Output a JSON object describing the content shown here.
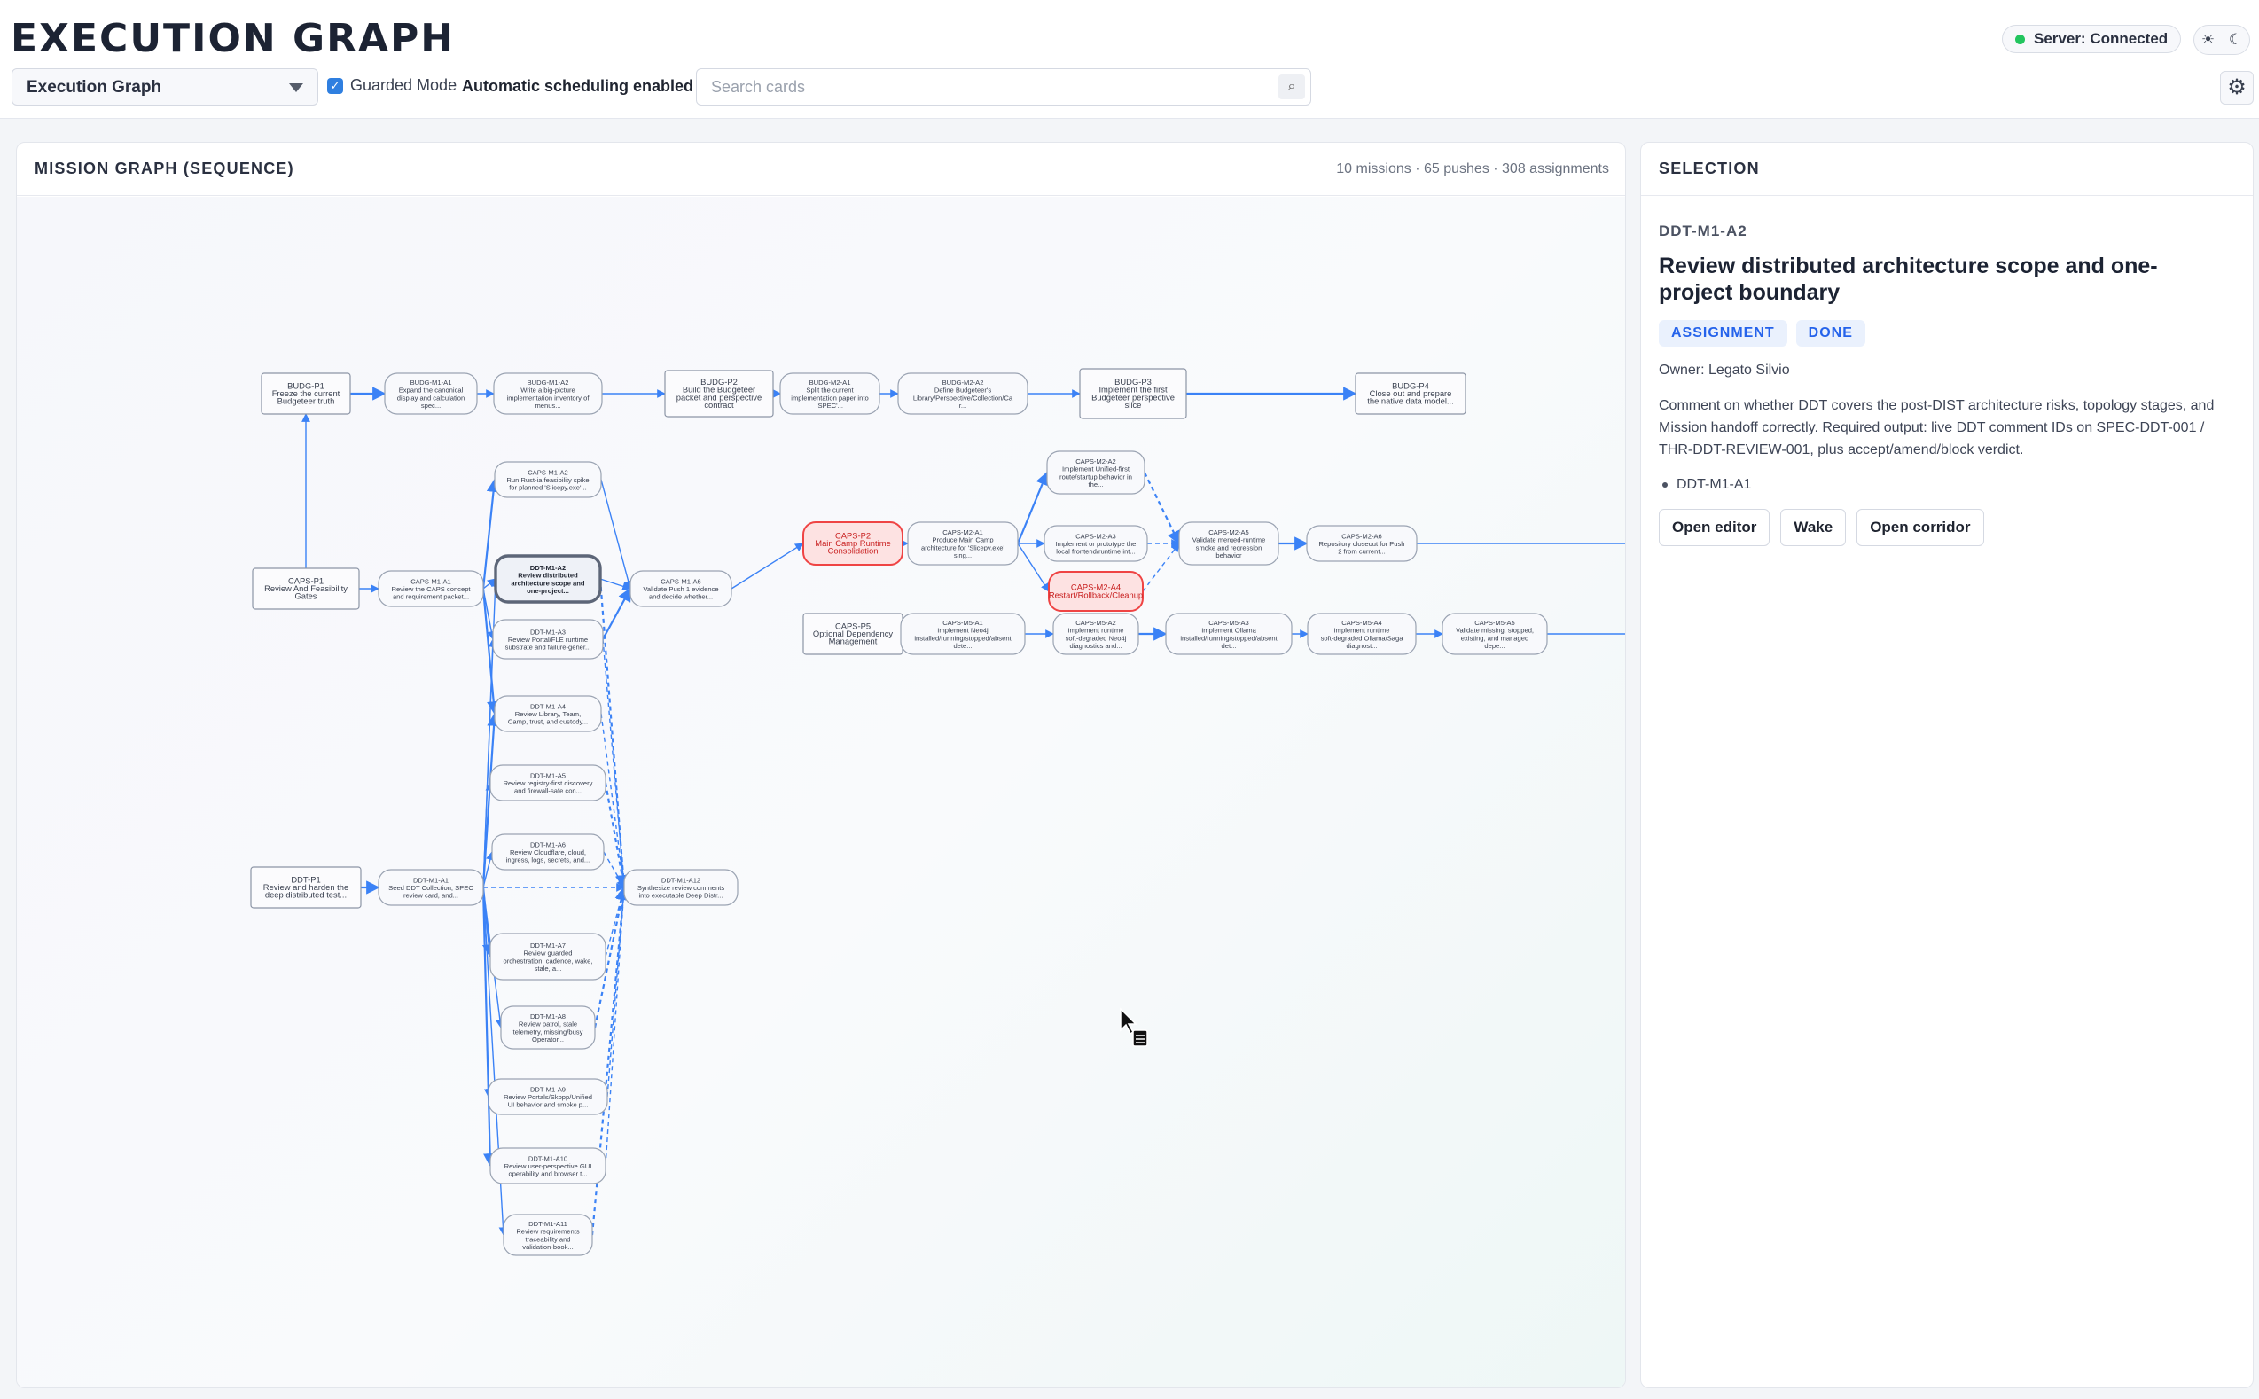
{
  "header": {
    "title": "EXECUTION GRAPH",
    "view_select": "Execution Graph",
    "guarded_mode_label": "Guarded Mode",
    "guarded_mode_checked": true,
    "scheduling_status": "Automatic scheduling enabled",
    "search_placeholder": "Search cards",
    "server_status": "Server: Connected",
    "server_status_color": "#22c55e"
  },
  "graph_panel": {
    "title": "MISSION GRAPH (SEQUENCE)",
    "stats": "10 missions · 65 pushes · 308 assignments",
    "accent_color": "#3b82f6",
    "alert_color": "#ef4444",
    "nodes": [
      {
        "id": "BUDG-P1",
        "lines": [
          "BUDG-P1",
          "Freeze the current",
          "Budgeteer truth"
        ],
        "kind": "push"
      },
      {
        "id": "BUDG-M1-A1",
        "lines": [
          "BUDG-M1-A1",
          "Expand the canonical",
          "display and calculation",
          "spec..."
        ],
        "kind": "assignment"
      },
      {
        "id": "BUDG-M1-A2",
        "lines": [
          "BUDG-M1-A2",
          "Write a big-picture",
          "implementation inventory of",
          "menus..."
        ],
        "kind": "assignment"
      },
      {
        "id": "BUDG-P2",
        "lines": [
          "BUDG-P2",
          "Build the Budgeteer",
          "packet and perspective",
          "contract"
        ],
        "kind": "push"
      },
      {
        "id": "BUDG-M2-A1",
        "lines": [
          "BUDG-M2-A1",
          "Split the current",
          "implementation paper into",
          "'SPEC'..."
        ],
        "kind": "assignment"
      },
      {
        "id": "BUDG-M2-A2",
        "lines": [
          "BUDG-M2-A2",
          "Define Budgeteer's",
          "Library/Perspective/Collection/Ca",
          "r..."
        ],
        "kind": "assignment"
      },
      {
        "id": "BUDG-P3",
        "lines": [
          "BUDG-P3",
          "Implement the first",
          "Budgeteer perspective",
          "slice"
        ],
        "kind": "push"
      },
      {
        "id": "BUDG-P4",
        "lines": [
          "BUDG-P4",
          "Close out and prepare",
          "the native data model..."
        ],
        "kind": "push"
      },
      {
        "id": "CAPS-M1-A2",
        "lines": [
          "CAPS-M1-A2",
          "Run Rust-ia feasibility spike",
          "for planned 'Slicepy.exe'..."
        ],
        "kind": "assignment"
      },
      {
        "id": "CAPS-P1",
        "lines": [
          "CAPS-P1",
          "Review And Feasibility",
          "Gates"
        ],
        "kind": "push"
      },
      {
        "id": "CAPS-M1-A1",
        "lines": [
          "CAPS-M1-A1",
          "Review the CAPS concept",
          "and requirement packet..."
        ],
        "kind": "assignment"
      },
      {
        "id": "DDT-M1-A2",
        "lines": [
          "DDT-M1-A2",
          "Review distributed",
          "architecture scope and",
          "one-project..."
        ],
        "kind": "selected"
      },
      {
        "id": "DDT-M1-A3",
        "lines": [
          "DDT-M1-A3",
          "Review Portal/FLE runtime",
          "substrate and failure-gener..."
        ],
        "kind": "assignment"
      },
      {
        "id": "CAPS-M1-A6",
        "lines": [
          "CAPS-M1-A6",
          "Validate Push 1 evidence",
          "and decide whether..."
        ],
        "kind": "assignment"
      },
      {
        "id": "CAPS-P2",
        "lines": [
          "CAPS-P2",
          "Main Camp Runtime",
          "Consolidation"
        ],
        "kind": "alert"
      },
      {
        "id": "CAPS-M2-A1",
        "lines": [
          "CAPS-M2-A1",
          "Produce Main Camp",
          "architecture for 'Slicepy.exe'",
          "sing..."
        ],
        "kind": "assignment"
      },
      {
        "id": "CAPS-M2-A2",
        "lines": [
          "CAPS-M2-A2",
          "Implement Unified-first",
          "route/startup behavior in",
          "the..."
        ],
        "kind": "assignment"
      },
      {
        "id": "CAPS-M2-A3",
        "lines": [
          "CAPS-M2-A3",
          "Implement or prototype the",
          "local frontend/runtime int..."
        ],
        "kind": "assignment"
      },
      {
        "id": "CAPS-M2-A4",
        "lines": [
          "CAPS-M2-A4",
          "Restart/Rollback/Cleanup"
        ],
        "kind": "alert"
      },
      {
        "id": "CAPS-M2-A5",
        "lines": [
          "CAPS-M2-A5",
          "Validate merged-runtime",
          "smoke and regression",
          "behavior"
        ],
        "kind": "assignment"
      },
      {
        "id": "CAPS-M2-A6",
        "lines": [
          "CAPS-M2-A6",
          "Repository closeout for Push",
          "2 from current..."
        ],
        "kind": "assignment"
      },
      {
        "id": "CAPS-P5",
        "lines": [
          "CAPS-P5",
          "Optional Dependency",
          "Management"
        ],
        "kind": "push"
      },
      {
        "id": "CAPS-M5-A1",
        "lines": [
          "CAPS-M5-A1",
          "Implement Neo4j",
          "installed/running/stopped/absent",
          "dete..."
        ],
        "kind": "assignment"
      },
      {
        "id": "CAPS-M5-A2",
        "lines": [
          "CAPS-M5-A2",
          "Implement runtime",
          "soft-degraded Neo4j",
          "diagnostics and..."
        ],
        "kind": "assignment"
      },
      {
        "id": "CAPS-M5-A3",
        "lines": [
          "CAPS-M5-A3",
          "Implement Ollama",
          "installed/running/stopped/absent",
          "det..."
        ],
        "kind": "assignment"
      },
      {
        "id": "CAPS-M5-A4",
        "lines": [
          "CAPS-M5-A4",
          "Implement runtime",
          "soft-degraded Ollama/Saga",
          "diagnost..."
        ],
        "kind": "assignment"
      },
      {
        "id": "CAPS-M5-A5",
        "lines": [
          "CAPS-M5-A5",
          "Validate missing, stopped,",
          "existing, and managed",
          "depe..."
        ],
        "kind": "assignment"
      },
      {
        "id": "DDT-M1-A4",
        "lines": [
          "DDT-M1-A4",
          "Review Library, Team,",
          "Camp, trust, and custody..."
        ],
        "kind": "assignment"
      },
      {
        "id": "DDT-M1-A5",
        "lines": [
          "DDT-M1-A5",
          "Review registry-first discovery",
          "and firewall-safe con..."
        ],
        "kind": "assignment"
      },
      {
        "id": "DDT-M1-A6",
        "lines": [
          "DDT-M1-A6",
          "Review Cloudflare, cloud,",
          "ingress, logs, secrets, and..."
        ],
        "kind": "assignment"
      },
      {
        "id": "DDT-P1",
        "lines": [
          "DDT-P1",
          "Review and harden the",
          "deep distributed test..."
        ],
        "kind": "push"
      },
      {
        "id": "DDT-M1-A1",
        "lines": [
          "DDT-M1-A1",
          "Seed DDT Collection, SPEC",
          "review card, and..."
        ],
        "kind": "assignment"
      },
      {
        "id": "DDT-M1-A12",
        "lines": [
          "DDT-M1-A12",
          "Synthesize review comments",
          "into executable Deep Distr..."
        ],
        "kind": "assignment"
      },
      {
        "id": "DDT-M1-A7",
        "lines": [
          "DDT-M1-A7",
          "Review guarded",
          "orchestration, cadence, wake,",
          "stale, a..."
        ],
        "kind": "assignment"
      },
      {
        "id": "DDT-M1-A8",
        "lines": [
          "DDT-M1-A8",
          "Review patrol, stale",
          "telemetry, missing/busy",
          "Operator..."
        ],
        "kind": "assignment"
      },
      {
        "id": "DDT-M1-A9",
        "lines": [
          "DDT-M1-A9",
          "Review Portals/Skopp/Unified",
          "UI behavior and smoke p..."
        ],
        "kind": "assignment"
      },
      {
        "id": "DDT-M1-A10",
        "lines": [
          "DDT-M1-A10",
          "Review user-perspective GUI",
          "operability and browser t..."
        ],
        "kind": "assignment"
      },
      {
        "id": "DDT-M1-A11",
        "lines": [
          "DDT-M1-A11",
          "Review requirements",
          "traceability and",
          "validation-book..."
        ],
        "kind": "assignment"
      }
    ],
    "edges": [
      [
        "BUDG-P1",
        "BUDG-M1-A1"
      ],
      [
        "BUDG-M1-A1",
        "BUDG-M1-A2"
      ],
      [
        "BUDG-M1-A2",
        "BUDG-P2"
      ],
      [
        "BUDG-P2",
        "BUDG-M2-A1"
      ],
      [
        "BUDG-M2-A1",
        "BUDG-M2-A2"
      ],
      [
        "BUDG-M2-A2",
        "BUDG-P3"
      ],
      [
        "BUDG-P3",
        "BUDG-P4"
      ],
      [
        "CAPS-P1",
        "BUDG-P1"
      ],
      [
        "CAPS-P1",
        "CAPS-M1-A1"
      ],
      [
        "CAPS-M1-A1",
        "CAPS-M1-A2"
      ],
      [
        "CAPS-M1-A1",
        "DDT-M1-A2"
      ],
      [
        "CAPS-M1-A1",
        "DDT-M1-A3"
      ],
      [
        "CAPS-M1-A1",
        "DDT-M1-A4"
      ],
      [
        "CAPS-M1-A2",
        "CAPS-M1-A6"
      ],
      [
        "DDT-M1-A2",
        "CAPS-M1-A6"
      ],
      [
        "DDT-M1-A3",
        "CAPS-M1-A6"
      ],
      [
        "CAPS-M1-A6",
        "CAPS-P2"
      ],
      [
        "CAPS-P2",
        "CAPS-M2-A1"
      ],
      [
        "CAPS-M2-A1",
        "CAPS-M2-A2"
      ],
      [
        "CAPS-M2-A1",
        "CAPS-M2-A3"
      ],
      [
        "CAPS-M2-A1",
        "CAPS-M2-A4"
      ],
      [
        "CAPS-M2-A2",
        "CAPS-M2-A5"
      ],
      [
        "CAPS-M2-A3",
        "CAPS-M2-A5"
      ],
      [
        "CAPS-M2-A4",
        "CAPS-M2-A5"
      ],
      [
        "CAPS-M2-A5",
        "CAPS-M2-A6"
      ],
      [
        "CAPS-P5",
        "CAPS-M5-A1"
      ],
      [
        "CAPS-M5-A1",
        "CAPS-M5-A2"
      ],
      [
        "CAPS-M5-A2",
        "CAPS-M5-A3"
      ],
      [
        "CAPS-M5-A3",
        "CAPS-M5-A4"
      ],
      [
        "CAPS-M5-A4",
        "CAPS-M5-A5"
      ],
      [
        "DDT-P1",
        "DDT-M1-A1"
      ],
      [
        "DDT-M1-A1",
        "DDT-M1-A2"
      ],
      [
        "DDT-M1-A1",
        "DDT-M1-A3"
      ],
      [
        "DDT-M1-A1",
        "DDT-M1-A4"
      ],
      [
        "DDT-M1-A1",
        "DDT-M1-A5"
      ],
      [
        "DDT-M1-A1",
        "DDT-M1-A6"
      ],
      [
        "DDT-M1-A1",
        "DDT-M1-A7"
      ],
      [
        "DDT-M1-A1",
        "DDT-M1-A8"
      ],
      [
        "DDT-M1-A1",
        "DDT-M1-A9"
      ],
      [
        "DDT-M1-A1",
        "DDT-M1-A10"
      ],
      [
        "DDT-M1-A1",
        "DDT-M1-A11"
      ],
      [
        "DDT-M1-A1",
        "DDT-M1-A12"
      ],
      [
        "DDT-M1-A2",
        "DDT-M1-A12"
      ],
      [
        "DDT-M1-A3",
        "DDT-M1-A12"
      ],
      [
        "DDT-M1-A4",
        "DDT-M1-A12"
      ],
      [
        "DDT-M1-A5",
        "DDT-M1-A12"
      ],
      [
        "DDT-M1-A6",
        "DDT-M1-A12"
      ],
      [
        "DDT-M1-A7",
        "DDT-M1-A12"
      ],
      [
        "DDT-M1-A8",
        "DDT-M1-A12"
      ],
      [
        "DDT-M1-A9",
        "DDT-M1-A12"
      ],
      [
        "DDT-M1-A10",
        "DDT-M1-A12"
      ],
      [
        "DDT-M1-A11",
        "DDT-M1-A12"
      ]
    ]
  },
  "selection": {
    "title": "SELECTION",
    "id": "DDT-M1-A2",
    "heading": "Review distributed architecture scope and one-project boundary",
    "badges": [
      "ASSIGNMENT",
      "DONE"
    ],
    "owner": "Owner: Legato Silvio",
    "comment": "Comment on whether DDT covers the post-DIST architecture risks, topology stages, and Mission handoff correctly. Required output: live DDT comment IDs on SPEC-DDT-001 / THR-DDT-REVIEW-001, plus accept/amend/block verdict.",
    "dependency": "DDT-M1-A1",
    "actions": [
      "Open editor",
      "Wake",
      "Open corridor"
    ]
  }
}
